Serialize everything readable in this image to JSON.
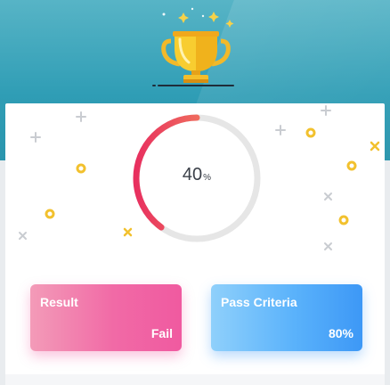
{
  "progress": {
    "value": "40",
    "unit": "%",
    "fraction": 0.4
  },
  "result": {
    "label": "Result",
    "value": "Fail"
  },
  "pass_criteria": {
    "label": "Pass Criteria",
    "value": "80%"
  },
  "colors": {
    "banner": "#2f9db5",
    "gauge_start": "#f7a35c",
    "gauge_end": "#e8305f",
    "gauge_track": "#e6e6e6",
    "result_box": "#f05aa0",
    "criteria_box": "#3d98f6",
    "confetti_gold": "#f2c12e",
    "confetti_grey": "#c9ccd1"
  },
  "icons": [
    "trophy-icon",
    "sparkle-icon",
    "confetti-ring-icon",
    "confetti-plus-icon",
    "confetti-cross-icon"
  ]
}
